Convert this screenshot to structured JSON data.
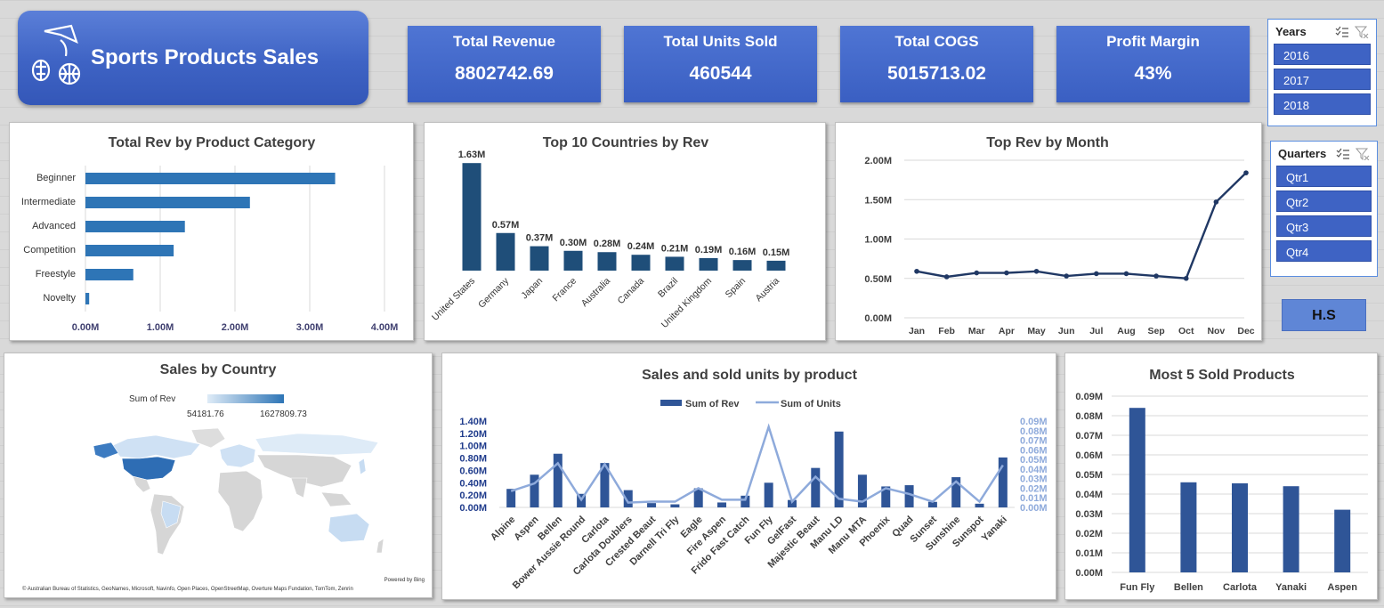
{
  "header": {
    "title": "Sports Products Sales"
  },
  "kpis": [
    {
      "label": "Total Revenue",
      "value": "8802742.69"
    },
    {
      "label": "Total Units Sold",
      "value": "460544"
    },
    {
      "label": "Total COGS",
      "value": "5015713.02"
    },
    {
      "label": "Profit Margin",
      "value": "43%"
    }
  ],
  "slicers": {
    "years": {
      "label": "Years",
      "items": [
        "2016",
        "2017",
        "2018"
      ]
    },
    "quarters": {
      "label": "Quarters",
      "items": [
        "Qtr1",
        "Qtr2",
        "Qtr3",
        "Qtr4"
      ]
    }
  },
  "author_badge": "H.S",
  "map": {
    "title": "Sales by Country",
    "legend_label": "Sum of Rev",
    "legend_min": "54181.76",
    "legend_max": "1627809.73",
    "powered_by": "Powered by Bing",
    "attribution": "© Australian Bureau of Statistics, GeoNames, Microsoft, Navinfo, Open Places, OpenStreetMap, Overture Maps Fundation, TomTom, Zenrin"
  },
  "colors": {
    "accent": "#3e63c4",
    "bar": "#2e75b6",
    "dark_bar": "#1f4e79",
    "line": "#8eaadb",
    "navy": "#203864",
    "mid_bar": "#2f5597"
  },
  "chart_data": [
    {
      "type": "bar",
      "orientation": "horizontal",
      "title": "Total Rev by Product Category",
      "categories": [
        "Beginner",
        "Intermediate",
        "Advanced",
        "Competition",
        "Freestyle",
        "Novelty"
      ],
      "values": [
        3.34,
        2.2,
        1.33,
        1.18,
        0.64,
        0.05
      ],
      "unit_suffix": "M",
      "xlim": [
        0,
        4
      ],
      "xticks": [
        "0.00M",
        "1.00M",
        "2.00M",
        "3.00M",
        "4.00M"
      ],
      "grid": true
    },
    {
      "type": "bar",
      "title": "Top 10 Countries by Rev",
      "categories": [
        "United States",
        "Germany",
        "Japan",
        "France",
        "Australia",
        "Canada",
        "Brazil",
        "United Kingdom",
        "Spain",
        "Austria"
      ],
      "values": [
        1.63,
        0.57,
        0.37,
        0.3,
        0.28,
        0.24,
        0.21,
        0.19,
        0.16,
        0.15
      ],
      "data_labels": [
        "1.63M",
        "0.57M",
        "0.37M",
        "0.30M",
        "0.28M",
        "0.24M",
        "0.21M",
        "0.19M",
        "0.16M",
        "0.15M"
      ],
      "ylim": [
        0,
        1.7
      ]
    },
    {
      "type": "line",
      "title": "Top  Rev by Month",
      "categories": [
        "Jan",
        "Feb",
        "Mar",
        "Apr",
        "May",
        "Jun",
        "Jul",
        "Aug",
        "Sep",
        "Oct",
        "Nov",
        "Dec"
      ],
      "values": [
        0.59,
        0.52,
        0.57,
        0.57,
        0.59,
        0.53,
        0.56,
        0.56,
        0.53,
        0.5,
        1.47,
        1.84
      ],
      "ylim": [
        0,
        2
      ],
      "yticks": [
        "0.00M",
        "0.50M",
        "1.00M",
        "1.50M",
        "2.00M"
      ],
      "grid": true
    },
    {
      "type": "bar",
      "title": "Sales and sold units by product",
      "legend": [
        "Sum of Rev",
        "Sum of Units"
      ],
      "legend_position": "top",
      "categories": [
        "Alpine",
        "Aspen",
        "Bellen",
        "Bower Aussie Round",
        "Carlota",
        "Carlota Doublers",
        "Crested Beaut",
        "Darnell Tri Fly",
        "Eagle",
        "Fire Aspen",
        "Frido Fast Catch",
        "Fun Fly",
        "GelFast",
        "Majestic Beaut",
        "Manu LD",
        "Manu MTA",
        "Phoenix",
        "Quad",
        "Sunset",
        "Sunshine",
        "Sunspot",
        "Yanaki"
      ],
      "series": [
        {
          "name": "Sum of Rev",
          "axis": "left",
          "values": [
            0.3,
            0.53,
            0.87,
            0.22,
            0.72,
            0.28,
            0.07,
            0.05,
            0.31,
            0.08,
            0.19,
            0.4,
            0.12,
            0.64,
            1.23,
            0.53,
            0.34,
            0.36,
            0.09,
            0.49,
            0.06,
            0.81
          ]
        },
        {
          "name": "Sum of Units",
          "axis": "right",
          "values": [
            0.017,
            0.025,
            0.046,
            0.008,
            0.045,
            0.005,
            0.006,
            0.006,
            0.02,
            0.008,
            0.008,
            0.084,
            0.006,
            0.032,
            0.009,
            0.006,
            0.02,
            0.014,
            0.006,
            0.027,
            0.006,
            0.044
          ]
        }
      ],
      "ylim": [
        0,
        1.4
      ],
      "yticks": [
        "0.00M",
        "0.20M",
        "0.40M",
        "0.60M",
        "0.80M",
        "1.00M",
        "1.20M",
        "1.40M"
      ],
      "y2lim": [
        0,
        0.09
      ],
      "y2ticks": [
        "0.00M",
        "0.01M",
        "0.02M",
        "0.03M",
        "0.04M",
        "0.05M",
        "0.06M",
        "0.07M",
        "0.08M",
        "0.09M"
      ]
    },
    {
      "type": "bar",
      "title": "Most  5 Sold Products",
      "categories": [
        "Fun Fly",
        "Bellen",
        "Carlota",
        "Yanaki",
        "Aspen"
      ],
      "values": [
        0.084,
        0.046,
        0.0455,
        0.044,
        0.032
      ],
      "ylim": [
        0,
        0.09
      ],
      "yticks": [
        "0.00M",
        "0.01M",
        "0.02M",
        "0.03M",
        "0.04M",
        "0.05M",
        "0.06M",
        "0.07M",
        "0.08M",
        "0.09M"
      ],
      "grid": true
    }
  ]
}
